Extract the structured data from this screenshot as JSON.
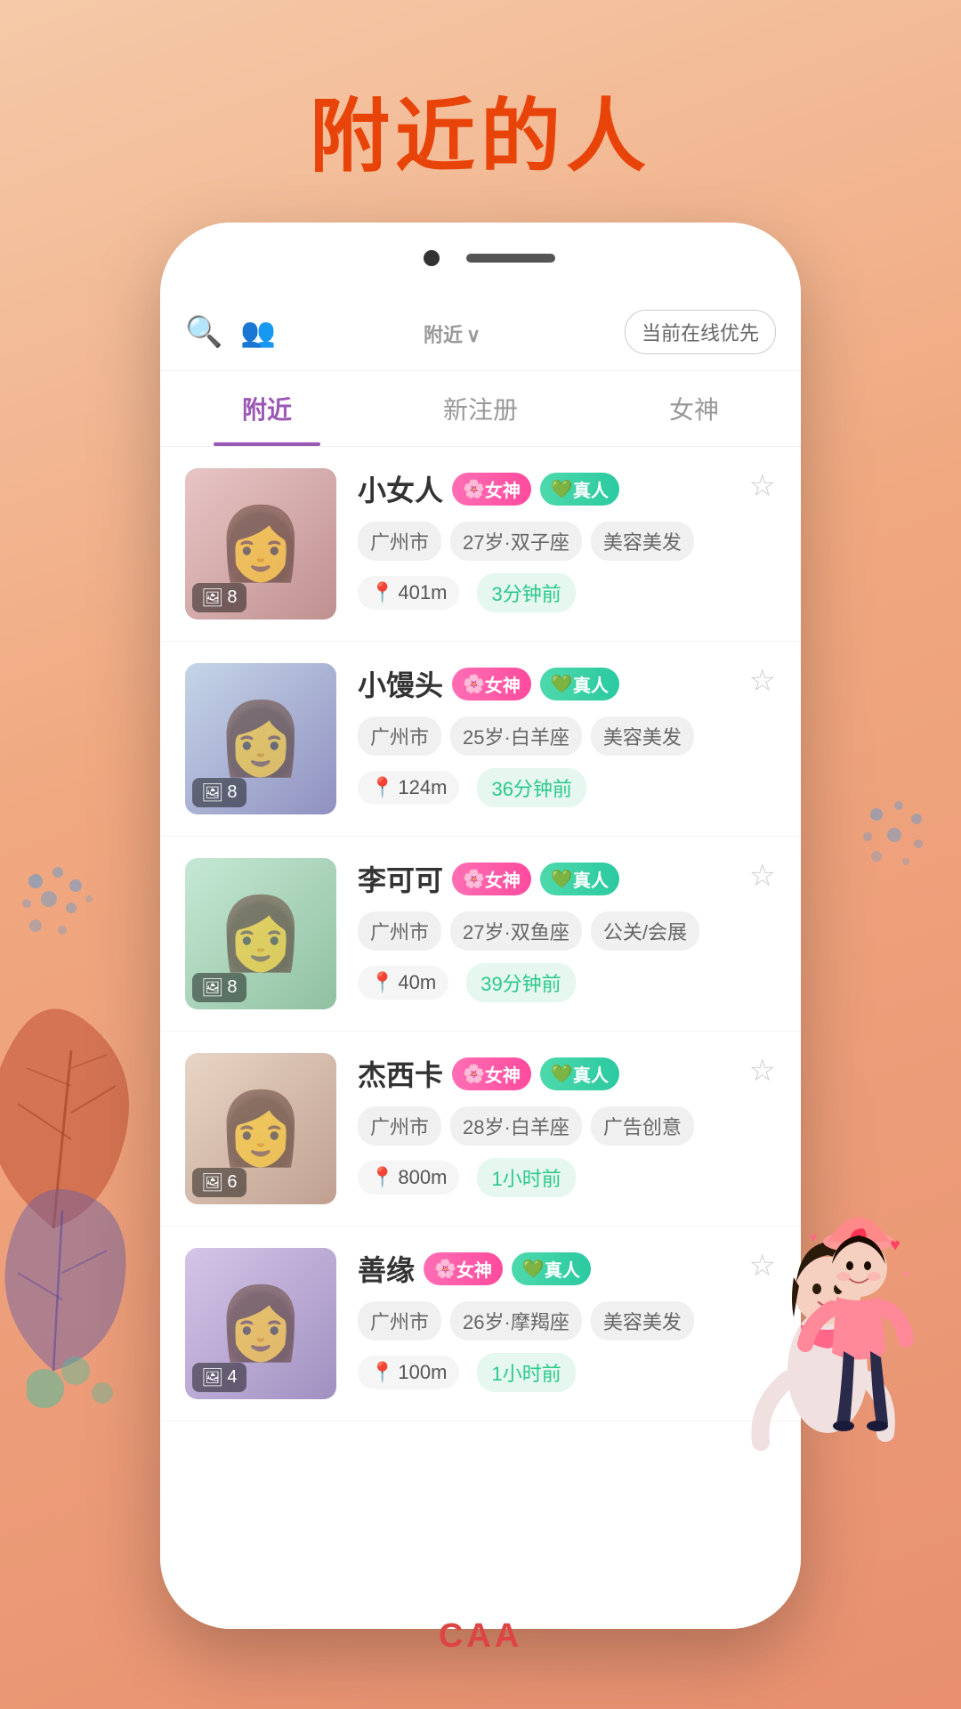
{
  "app": {
    "title": "附近的人",
    "page_title": "附近的人"
  },
  "header": {
    "title": "附近",
    "title_suffix": "∨",
    "online_btn": "当前在线优先",
    "search_icon": "🔍",
    "filter_icon": "👥"
  },
  "tabs": [
    {
      "id": "nearby",
      "label": "附近",
      "active": true
    },
    {
      "id": "new_register",
      "label": "新注册",
      "active": false
    },
    {
      "id": "goddess",
      "label": "女神",
      "active": false
    }
  ],
  "users": [
    {
      "id": 1,
      "name": "小女人",
      "badges": [
        "女神",
        "真人"
      ],
      "city": "广州市",
      "age": "27岁",
      "zodiac": "双子座",
      "occupation": "美容美发",
      "distance": "401m",
      "time_ago": "3分钟前",
      "photo_count": 8,
      "avatar_class": "avatar-1"
    },
    {
      "id": 2,
      "name": "小馒头",
      "badges": [
        "女神",
        "真人"
      ],
      "city": "广州市",
      "age": "25岁",
      "zodiac": "白羊座",
      "occupation": "美容美发",
      "distance": "124m",
      "time_ago": "36分钟前",
      "photo_count": 8,
      "avatar_class": "avatar-2"
    },
    {
      "id": 3,
      "name": "李可可",
      "badges": [
        "女神",
        "真人"
      ],
      "city": "广州市",
      "age": "27岁",
      "zodiac": "双鱼座",
      "occupation": "公关/会展",
      "distance": "40m",
      "time_ago": "39分钟前",
      "photo_count": 8,
      "avatar_class": "avatar-3"
    },
    {
      "id": 4,
      "name": "杰西卡",
      "badges": [
        "女神",
        "真人"
      ],
      "city": "广州市",
      "age": "28岁",
      "zodiac": "白羊座",
      "occupation": "广告创意",
      "distance": "800m",
      "time_ago": "1小时前",
      "photo_count": 6,
      "avatar_class": "avatar-4"
    },
    {
      "id": 5,
      "name": "善缘",
      "badges": [
        "女神",
        "真人"
      ],
      "city": "广州市",
      "age": "26岁",
      "zodiac": "摩羯座",
      "occupation": "美容美发",
      "distance": "100m",
      "time_ago": "1小时前",
      "photo_count": 4,
      "avatar_class": "avatar-5"
    }
  ],
  "badge_labels": {
    "goddess": "女神",
    "real": "真人"
  },
  "bottom_text": "CAA"
}
